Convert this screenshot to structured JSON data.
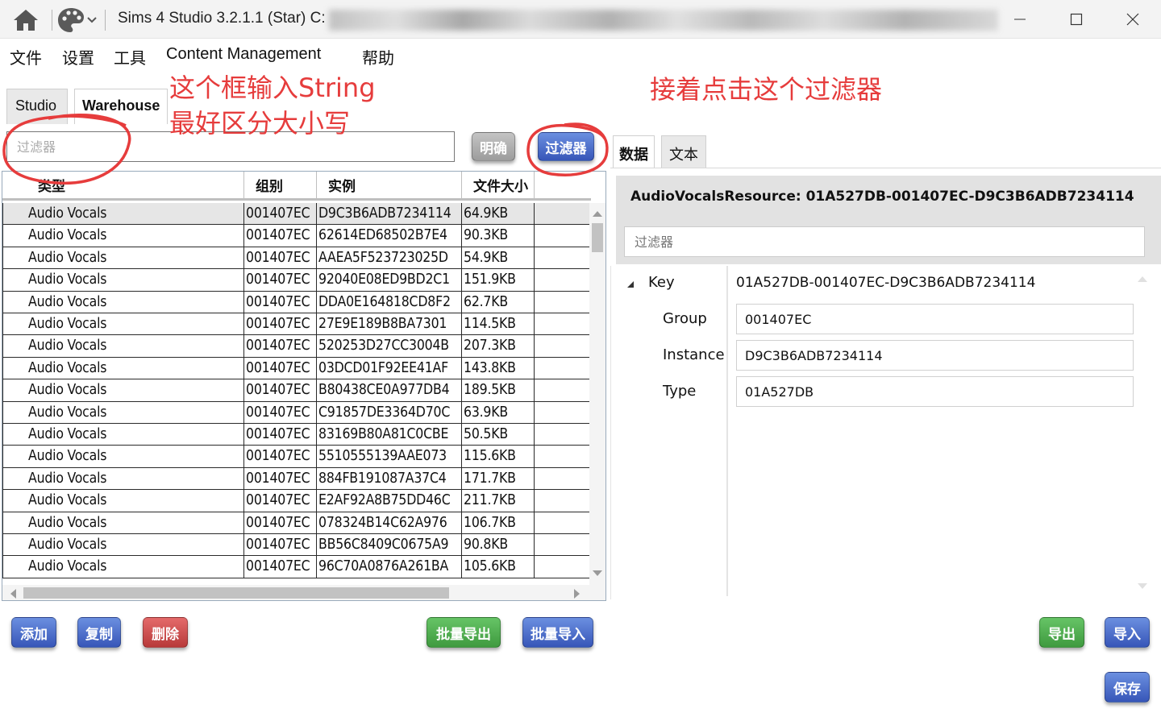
{
  "window": {
    "title": "Sims 4 Studio 3.2.1.1 (Star)  C:",
    "controls": {
      "minimize": "—",
      "maximize": "☐",
      "close": "✕"
    }
  },
  "menu": [
    "文件",
    "设置",
    "工具",
    "Content Management",
    "帮助"
  ],
  "tabs": {
    "studio": "Studio",
    "warehouse": "Warehouse"
  },
  "filter": {
    "placeholder": "过滤器",
    "clear_label": "明确",
    "filter_label": "过滤器"
  },
  "table": {
    "headers": [
      "类型",
      "组别",
      "实例",
      "文件大小"
    ],
    "rows": [
      [
        "Audio Vocals",
        "001407EC",
        "D9C3B6ADB7234114",
        "64.9KB"
      ],
      [
        "Audio Vocals",
        "001407EC",
        "62614ED68502B7E4",
        "90.3KB"
      ],
      [
        "Audio Vocals",
        "001407EC",
        "AAEA5F523723025D",
        "54.9KB"
      ],
      [
        "Audio Vocals",
        "001407EC",
        "92040E08ED9BD2C1",
        "151.9KB"
      ],
      [
        "Audio Vocals",
        "001407EC",
        "DDA0E164818CD8F2",
        "62.7KB"
      ],
      [
        "Audio Vocals",
        "001407EC",
        "27E9E189B8BA7301",
        "114.5KB"
      ],
      [
        "Audio Vocals",
        "001407EC",
        "520253D27CC3004B",
        "207.3KB"
      ],
      [
        "Audio Vocals",
        "001407EC",
        "03DCD01F92EE41AF",
        "143.8KB"
      ],
      [
        "Audio Vocals",
        "001407EC",
        "B80438CE0A977DB4",
        "189.5KB"
      ],
      [
        "Audio Vocals",
        "001407EC",
        "C91857DE3364D70C",
        "63.9KB"
      ],
      [
        "Audio Vocals",
        "001407EC",
        "83169B80A81C0CBE",
        "50.5KB"
      ],
      [
        "Audio Vocals",
        "001407EC",
        "5510555139AAE073",
        "115.6KB"
      ],
      [
        "Audio Vocals",
        "001407EC",
        "884FB191087A37C4",
        "171.7KB"
      ],
      [
        "Audio Vocals",
        "001407EC",
        "E2AF92A8B75DD46C",
        "211.7KB"
      ],
      [
        "Audio Vocals",
        "001407EC",
        "078324B14C62A976",
        "106.7KB"
      ],
      [
        "Audio Vocals",
        "001407EC",
        "BB56C8409C0675A9",
        "90.8KB"
      ],
      [
        "Audio Vocals",
        "001407EC",
        "96C70A0876A261BA",
        "105.6KB"
      ]
    ]
  },
  "right_panel": {
    "tabs": {
      "data": "数据",
      "text": "文本"
    },
    "title": "AudioVocalsResource: 01A527DB-001407EC-D9C3B6ADB7234114",
    "filter_placeholder": "过滤器",
    "key_label": "Key",
    "key_value": "01A527DB-001407EC-D9C3B6ADB7234114",
    "group_label": "Group",
    "group_value": "001407EC",
    "instance_label": "Instance",
    "instance_value": "D9C3B6ADB7234114",
    "type_label": "Type",
    "type_value": "01A527DB"
  },
  "buttons": {
    "add": "添加",
    "copy": "复制",
    "delete": "删除",
    "batch_export": "批量导出",
    "batch_import": "批量导入",
    "export": "导出",
    "import": "导入",
    "save": "保存"
  },
  "annotations": {
    "line1": "这个框输入String",
    "line2": "最好区分大小写",
    "right": "接着点击这个过滤器"
  },
  "colors": {
    "blue_button": "#3f62c2",
    "red_button": "#c44848",
    "green_button": "#4aa84a",
    "annotation_red": "#e63c3c",
    "selected_row": "#e6e6e6"
  }
}
